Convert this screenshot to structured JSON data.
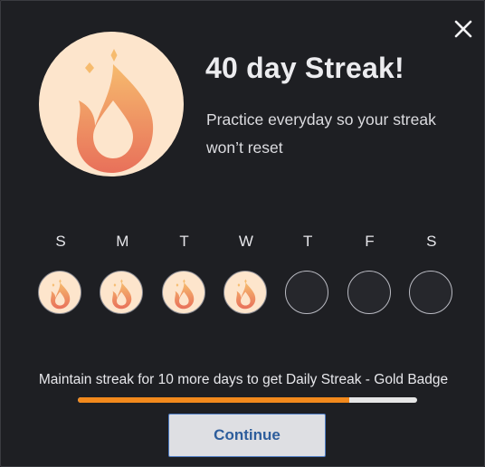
{
  "modal": {
    "title": "40 day Streak!",
    "subtitle": "Practice everyday so your streak won’t reset",
    "close_icon": "close-icon"
  },
  "hero": {
    "icon": "flame-icon",
    "badge_color": "#fde5cc"
  },
  "week": {
    "days": [
      {
        "letter": "S",
        "completed": true
      },
      {
        "letter": "M",
        "completed": true
      },
      {
        "letter": "T",
        "completed": true
      },
      {
        "letter": "W",
        "completed": true
      },
      {
        "letter": "T",
        "completed": false
      },
      {
        "letter": "F",
        "completed": false
      },
      {
        "letter": "S",
        "completed": false
      }
    ]
  },
  "progress": {
    "label": "Maintain streak for 10 more days to get Daily Streak - Gold Badge",
    "fraction": 0.8,
    "fill_color": "#f2891c"
  },
  "actions": {
    "continue_label": "Continue"
  },
  "colors": {
    "background": "#1e1f23",
    "flame_light": "#f5b06a",
    "flame_dark": "#e8705a",
    "button_text": "#2d5d9c"
  }
}
